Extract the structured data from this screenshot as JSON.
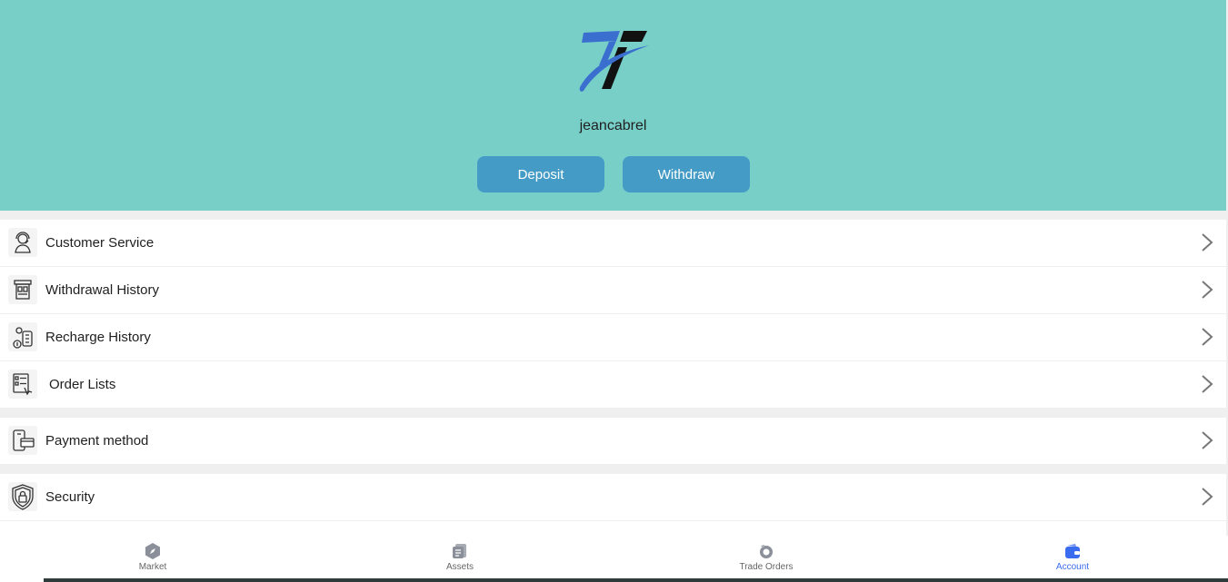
{
  "user": {
    "username": "jeancabrel"
  },
  "actions": {
    "deposit_label": "Deposit",
    "withdraw_label": "Withdraw"
  },
  "menu": [
    {
      "label": "Customer Service",
      "icon": "customer-service-icon"
    },
    {
      "label": "Withdrawal History",
      "icon": "withdrawal-history-icon"
    },
    {
      "label": "Recharge History",
      "icon": "recharge-history-icon"
    },
    {
      "label": "Order Lists",
      "icon": "order-list-icon"
    },
    {
      "label": "Payment method",
      "icon": "payment-method-icon"
    },
    {
      "label": "Security",
      "icon": "security-shield-icon"
    }
  ],
  "tabs": [
    {
      "label": "Market",
      "icon": "compass-icon",
      "active": false
    },
    {
      "label": "Assets",
      "icon": "assets-icon",
      "active": false
    },
    {
      "label": "Trade Orders",
      "icon": "trade-orders-icon",
      "active": false
    },
    {
      "label": "Account",
      "icon": "wallet-icon",
      "active": true
    }
  ],
  "colors": {
    "header_bg": "#77cfc8",
    "button_bg": "#449bc6",
    "tab_active": "#3a6cf0",
    "tab_inactive": "#8a8f99"
  }
}
